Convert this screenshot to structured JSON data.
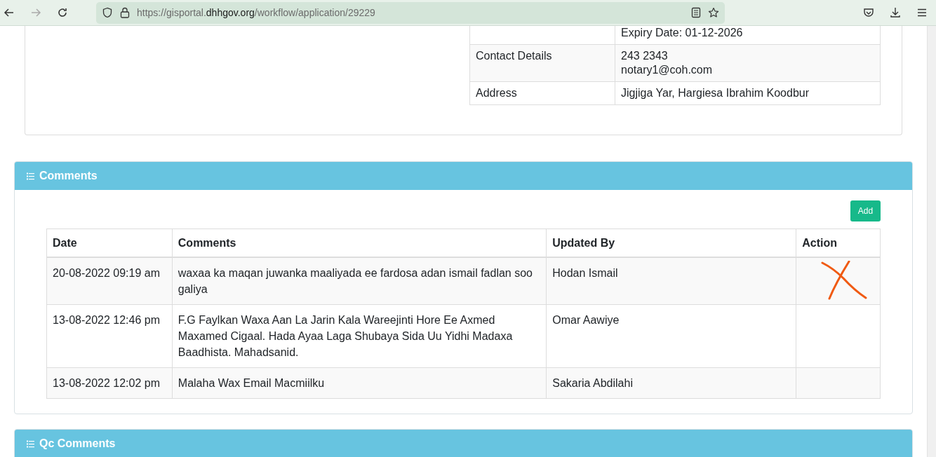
{
  "browser": {
    "url_prefix": "https://gisportal.",
    "url_domain": "dhhgov.org",
    "url_path": "/workflow/application/29229"
  },
  "details": {
    "rows": [
      {
        "value_lines": [
          "Expiry Date: 01-12-2026"
        ]
      },
      {
        "label": "Contact Details",
        "value_lines": [
          "243 2343",
          "notary1@coh.com"
        ]
      },
      {
        "label": "Address",
        "value_lines": [
          "Jigjiga Yar, Hargiesa Ibrahim Koodbur"
        ]
      }
    ]
  },
  "comments": {
    "title": "Comments",
    "add_button": "Add",
    "columns": [
      "Date",
      "Comments",
      "Updated By",
      "Action"
    ],
    "rows": [
      {
        "date": "20-08-2022 09:19 am",
        "comment": "waxaa ka maqan juwanka maaliyada ee fardosa adan ismail fadlan soo galiya",
        "updated_by": "Hodan Ismail",
        "marked": true
      },
      {
        "date": "13-08-2022 12:46 pm",
        "comment": "F.G Faylkan Waxa Aan La Jarin Kala Wareejinti Hore Ee Axmed Maxamed Cigaal. Hada Ayaa Laga Shubaya Sida Uu Yidhi Madaxa Baadhista. Mahadsanid.",
        "updated_by": "Omar Aawiye",
        "marked": false
      },
      {
        "date": "13-08-2022 12:02 pm",
        "comment": "Malaha Wax Email Macmiilku",
        "updated_by": "Sakaria Abdilahi",
        "marked": false
      }
    ]
  },
  "qc_comments": {
    "title": "Qc Comments"
  }
}
